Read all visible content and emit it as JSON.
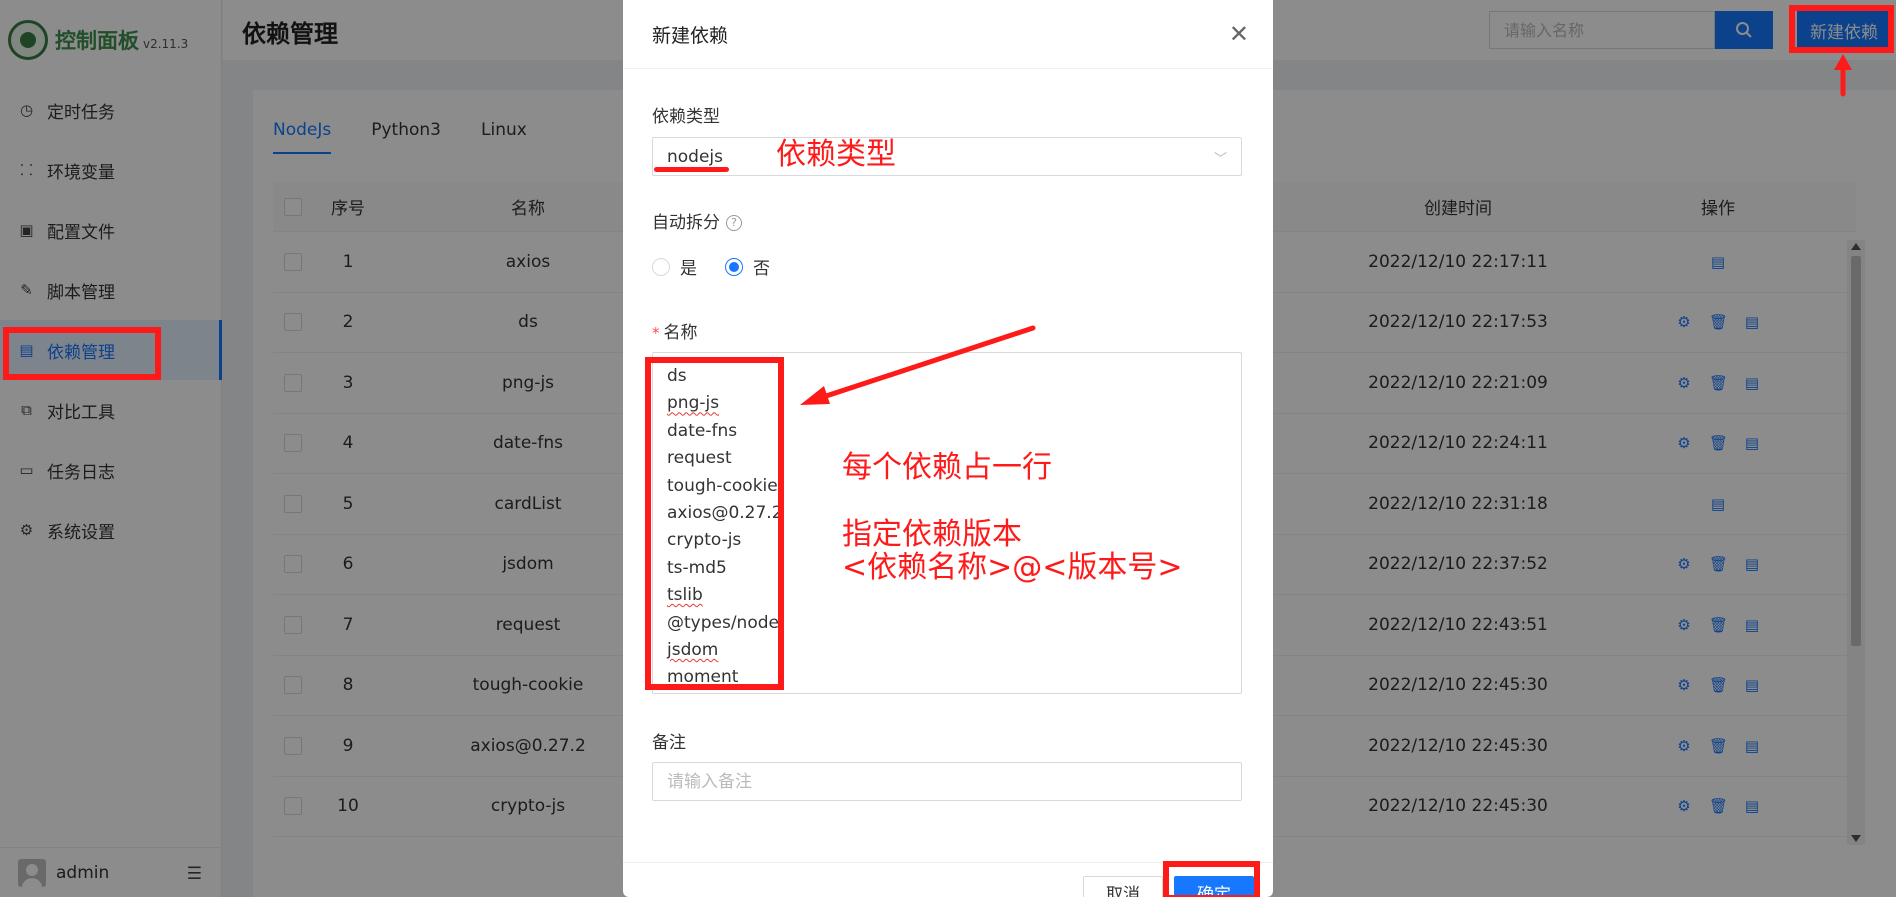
{
  "app": {
    "title": "控制面板",
    "version": "v2.11.3"
  },
  "sidebar": {
    "items": [
      {
        "label": "定时任务",
        "icon": "clock-icon"
      },
      {
        "label": "环境变量",
        "icon": "variable-icon"
      },
      {
        "label": "配置文件",
        "icon": "control-icon"
      },
      {
        "label": "脚本管理",
        "icon": "edit-icon"
      },
      {
        "label": "依赖管理",
        "icon": "file-icon",
        "active": true
      },
      {
        "label": "对比工具",
        "icon": "diff-icon"
      },
      {
        "label": "任务日志",
        "icon": "folder-icon"
      },
      {
        "label": "系统设置",
        "icon": "gear-icon"
      }
    ],
    "user": "admin"
  },
  "header": {
    "title": "依赖管理",
    "search_placeholder": "请输入名称",
    "new_button": "新建依赖"
  },
  "tabs": [
    {
      "label": "NodeJs",
      "active": true
    },
    {
      "label": "Python3"
    },
    {
      "label": "Linux"
    }
  ],
  "table": {
    "columns": {
      "index": "序号",
      "name": "名称",
      "created": "创建时间",
      "ops": "操作"
    },
    "rows": [
      {
        "index": "1",
        "name": "axios",
        "created": "2022/12/10 22:17:11",
        "ops": [
          "log"
        ]
      },
      {
        "index": "2",
        "name": "ds",
        "created": "2022/12/10 22:17:53",
        "ops": [
          "debug",
          "delete",
          "log"
        ]
      },
      {
        "index": "3",
        "name": "png-js",
        "created": "2022/12/10 22:21:09",
        "ops": [
          "debug",
          "delete",
          "log"
        ]
      },
      {
        "index": "4",
        "name": "date-fns",
        "created": "2022/12/10 22:24:11",
        "ops": [
          "debug",
          "delete",
          "log"
        ]
      },
      {
        "index": "5",
        "name": "cardList",
        "created": "2022/12/10 22:31:18",
        "ops": [
          "log"
        ]
      },
      {
        "index": "6",
        "name": "jsdom",
        "created": "2022/12/10 22:37:52",
        "ops": [
          "debug",
          "delete",
          "log"
        ]
      },
      {
        "index": "7",
        "name": "request",
        "created": "2022/12/10 22:43:51",
        "ops": [
          "debug",
          "delete",
          "log"
        ]
      },
      {
        "index": "8",
        "name": "tough-cookie",
        "created": "2022/12/10 22:45:30",
        "ops": [
          "debug",
          "delete",
          "log"
        ]
      },
      {
        "index": "9",
        "name": "axios@0.27.2",
        "created": "2022/12/10 22:45:30",
        "ops": [
          "debug",
          "delete",
          "log"
        ]
      },
      {
        "index": "10",
        "name": "crypto-js",
        "created": "2022/12/10 22:45:30",
        "ops": [
          "debug",
          "delete",
          "log"
        ]
      }
    ]
  },
  "modal": {
    "title": "新建依赖",
    "type_label": "依赖类型",
    "type_value": "nodejs",
    "split_label": "自动拆分",
    "split_options": [
      "是",
      "否"
    ],
    "split_selected": "否",
    "name_label": "名称",
    "name_lines": [
      "ds",
      "png-js",
      "date-fns",
      "request",
      "tough-cookie",
      "axios@0.27.2",
      "crypto-js",
      "ts-md5",
      "tslib",
      "@types/node",
      "jsdom",
      "moment"
    ],
    "remark_label": "备注",
    "remark_placeholder": "请输入备注",
    "cancel": "取消",
    "ok": "确定"
  },
  "annotations": {
    "type_note": "依赖类型",
    "line_note": "每个依赖占一行",
    "version_note_1": "指定依赖版本",
    "version_note_2": "<依赖名称>@<版本号>"
  },
  "colors": {
    "primary": "#1677ff",
    "annotation": "#ff1a1a",
    "logo_green": "#3f8f4b"
  }
}
